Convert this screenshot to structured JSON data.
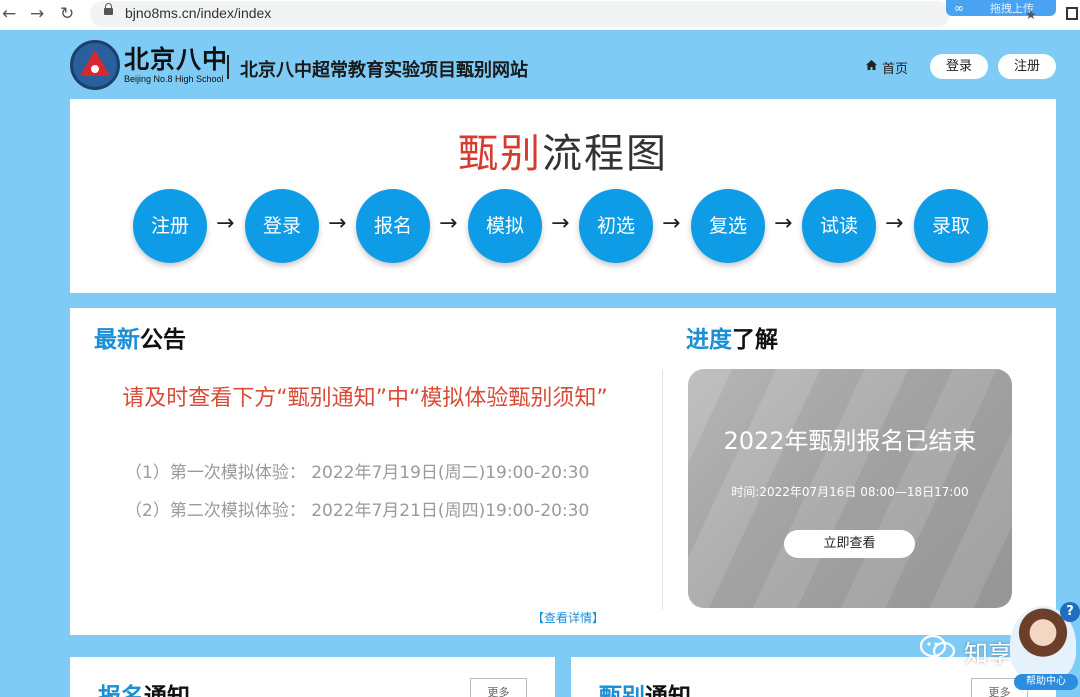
{
  "browser": {
    "back": "←",
    "forward": "→",
    "reload": "↻",
    "url": "bjno8ms.cn/index/index",
    "extension_label": "拖拽上传"
  },
  "header": {
    "logo_cn": "北京八中",
    "logo_en": "Beijing No.8 High School",
    "site_title": "北京八中超常教育实验项目甄别网站",
    "nav": {
      "home": "首页",
      "login": "登录",
      "register": "注册"
    }
  },
  "flow": {
    "title_highlight": "甄别",
    "title_rest": "流程图",
    "steps": [
      "注册",
      "登录",
      "报名",
      "模拟",
      "初选",
      "复选",
      "试读",
      "录取"
    ],
    "arrow": "→"
  },
  "notice": {
    "heading_blue": "最新",
    "heading_black": "公告",
    "headline": "请及时查看下方“甄别通知”中“模拟体验甄别须知”",
    "lines": [
      "（1）第一次模拟体验： 2022年7月19日(周二)19:00-20:30",
      "（2）第二次模拟体验： 2022年7月21日(周四)19:00-20:30"
    ],
    "detail_link": "【查看详情】"
  },
  "progress": {
    "heading_blue": "进度",
    "heading_black": "了解",
    "status_title": "2022年甄别报名已结束",
    "status_time": "时间:2022年07月16日 08:00—18日17:00",
    "button": "立即查看"
  },
  "bottom": {
    "left": {
      "heading_blue": "报名",
      "heading_black": "通知",
      "more": "更多"
    },
    "right": {
      "heading_blue": "甄别",
      "heading_black": "通知",
      "more": "更多"
    }
  },
  "overlay": {
    "watermark": "知享堂",
    "help_label": "帮助中心",
    "help_q": "?"
  },
  "colors": {
    "page_bg": "#7ecbf6",
    "step_blue": "#0f9ce6",
    "accent_red": "#d73a2f",
    "heading_blue": "#1a8fd6"
  }
}
